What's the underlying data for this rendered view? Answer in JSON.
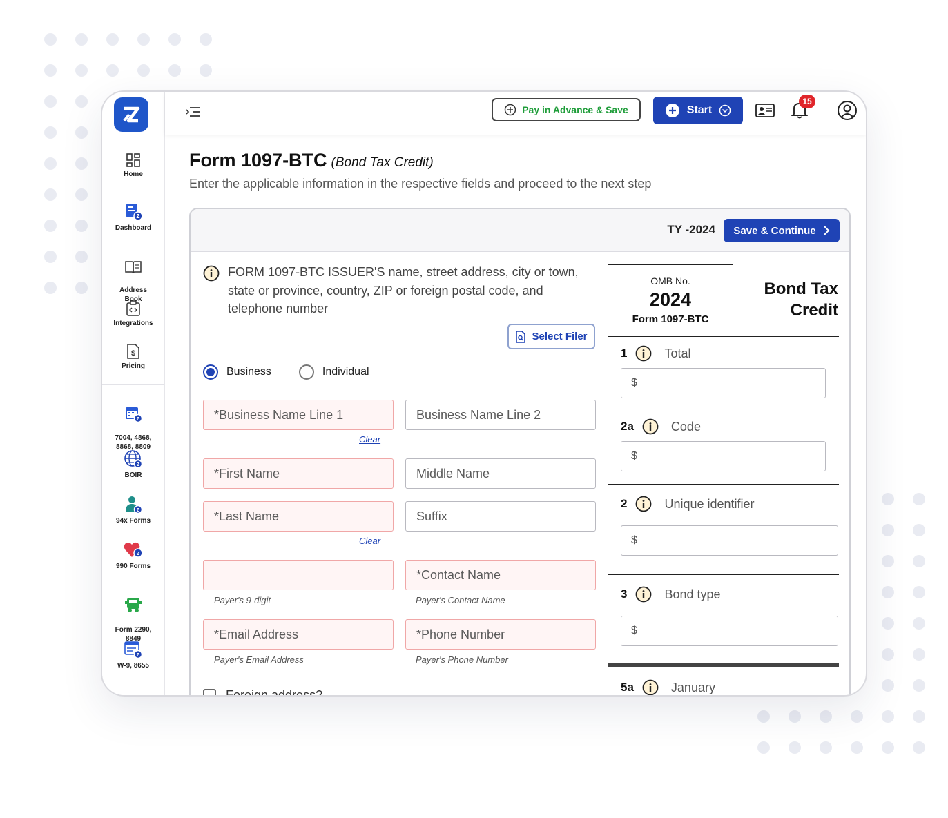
{
  "app": {
    "logo_text": "Z"
  },
  "sidebar": {
    "items": [
      {
        "id": "home",
        "label": "Home"
      },
      {
        "id": "dashboard",
        "label": "Dashboard"
      },
      {
        "id": "address-book",
        "label": "Address\nBook"
      },
      {
        "id": "integrations",
        "label": "Integrations"
      },
      {
        "id": "pricing",
        "label": "Pricing"
      },
      {
        "id": "extension-forms",
        "label": "7004, 4868,\n8868, 8809"
      },
      {
        "id": "boir",
        "label": "BOIR"
      },
      {
        "id": "94x-forms",
        "label": "94x Forms"
      },
      {
        "id": "990-forms",
        "label": "990 Forms"
      },
      {
        "id": "form-2290",
        "label": "Form 2290,\n8849"
      },
      {
        "id": "w9",
        "label": "W-9, 8655"
      }
    ]
  },
  "topbar": {
    "pay_label": "Pay in Advance & Save",
    "start_label": "Start",
    "notification_count": "15"
  },
  "page": {
    "title": "Form 1097-BTC",
    "title_suffix": "(Bond Tax Credit)",
    "subtitle": "Enter the applicable information in the respective fields and proceed to the next step"
  },
  "card": {
    "tax_year": "TY -2024",
    "save_label": "Save & Continue",
    "issuer_text": "FORM 1097-BTC ISSUER'S name, street address, city or town, state or province, country, ZIP or foreign postal code, and telephone number",
    "select_filer_label": "Select Filer",
    "entity_options": [
      {
        "label": "Business",
        "selected": true
      },
      {
        "label": "Individual",
        "selected": false
      }
    ],
    "fields": {
      "business_name_1": "*Business Name Line 1",
      "business_name_2": "Business Name Line 2",
      "first_name": "*First Name",
      "middle_name": "Middle Name",
      "last_name": "*Last Name",
      "suffix": "Suffix",
      "tin": "",
      "contact_name": "*Contact Name",
      "email": "*Email Address",
      "phone": "*Phone Number"
    },
    "hints": {
      "tin": "Payer's 9-digit",
      "contact": "Payer's Contact Name",
      "email": "Payer's Email Address",
      "phone": "Payer's Phone Number"
    },
    "clear_label": "Clear",
    "foreign_address_label": "Foreign address?"
  },
  "form_panel": {
    "omb_label": "OMB No.",
    "year": "2024",
    "form_name": "Form 1097-BTC",
    "heading": "Bond Tax Credit",
    "boxes": [
      {
        "num": "1",
        "label": "Total",
        "value": "$"
      },
      {
        "num": "2a",
        "label": "Code",
        "value": "$"
      },
      {
        "num": "2",
        "label": "Unique identifier",
        "value": "$"
      },
      {
        "num": "3",
        "label": "Bond type",
        "value": "$"
      },
      {
        "num": "5a",
        "label": "January"
      }
    ]
  },
  "colors": {
    "primary": "#1f43b5",
    "accent_green": "#1f9d3a",
    "required_bg": "#fff5f5",
    "badge": "#e0262b"
  }
}
